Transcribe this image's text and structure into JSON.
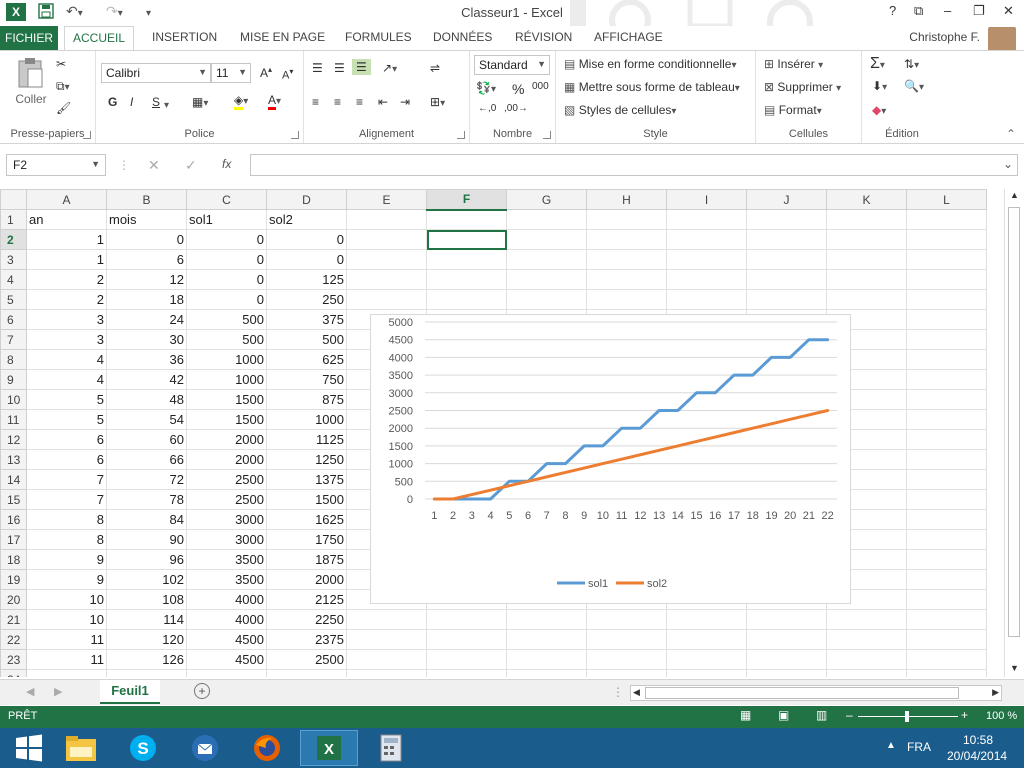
{
  "titlebar": {
    "title": "Classeur1 - Excel",
    "app_icon": "X",
    "help": "?",
    "buttons": [
      "?",
      "⧉",
      "–",
      "❐",
      "✕"
    ]
  },
  "tabs": {
    "file": "FICHIER",
    "items": [
      "ACCUEIL",
      "INSERTION",
      "MISE EN PAGE",
      "FORMULES",
      "DONNÉES",
      "RÉVISION",
      "AFFICHAGE"
    ],
    "active": "ACCUEIL",
    "user": "Christophe F."
  },
  "ribbon": {
    "clipboard": {
      "paste_label": "Coller",
      "group_label": "Presse-papiers"
    },
    "font": {
      "name": "Calibri",
      "size": "11",
      "bold": "G",
      "italic": "I",
      "underline": "S",
      "group_label": "Police"
    },
    "alignment": {
      "group_label": "Alignement"
    },
    "number": {
      "format": "Standard",
      "percent": "%",
      "thousands": "000",
      "group_label": "Nombre"
    },
    "styles": {
      "conditional": "Mise en forme conditionnelle",
      "table": "Mettre sous forme de tableau",
      "cell_styles": "Styles de cellules",
      "group_label": "Style"
    },
    "cells": {
      "insert": "Insérer",
      "delete": "Supprimer",
      "format": "Format",
      "group_label": "Cellules"
    },
    "editing": {
      "group_label": "Édition"
    }
  },
  "formula_bar": {
    "name_box": "F2",
    "fx": "fx",
    "value": ""
  },
  "sheet": {
    "columns": [
      "A",
      "B",
      "C",
      "D",
      "E",
      "F",
      "G",
      "H",
      "I",
      "J",
      "K",
      "L"
    ],
    "selected_cell": "F2",
    "header_row": [
      "an",
      "mois",
      "sol1",
      "sol2"
    ],
    "rows": [
      [
        1,
        0,
        0,
        0
      ],
      [
        1,
        6,
        0,
        0
      ],
      [
        2,
        12,
        0,
        125
      ],
      [
        2,
        18,
        0,
        250
      ],
      [
        3,
        24,
        500,
        375
      ],
      [
        3,
        30,
        500,
        500
      ],
      [
        4,
        36,
        1000,
        625
      ],
      [
        4,
        42,
        1000,
        750
      ],
      [
        5,
        48,
        1500,
        875
      ],
      [
        5,
        54,
        1500,
        1000
      ],
      [
        6,
        60,
        2000,
        1125
      ],
      [
        6,
        66,
        2000,
        1250
      ],
      [
        7,
        72,
        2500,
        1375
      ],
      [
        7,
        78,
        2500,
        1500
      ],
      [
        8,
        84,
        3000,
        1625
      ],
      [
        8,
        90,
        3000,
        1750
      ],
      [
        9,
        96,
        3500,
        1875
      ],
      [
        9,
        102,
        3500,
        2000
      ],
      [
        10,
        108,
        4000,
        2125
      ],
      [
        10,
        114,
        4000,
        2250
      ],
      [
        11,
        120,
        4500,
        2375
      ],
      [
        11,
        126,
        4500,
        2500
      ]
    ]
  },
  "chart_data": {
    "type": "line",
    "x": [
      1,
      2,
      3,
      4,
      5,
      6,
      7,
      8,
      9,
      10,
      11,
      12,
      13,
      14,
      15,
      16,
      17,
      18,
      19,
      20,
      21,
      22
    ],
    "series": [
      {
        "name": "sol1",
        "color": "#5b9bd5",
        "values": [
          0,
          0,
          0,
          0,
          500,
          500,
          1000,
          1000,
          1500,
          1500,
          2000,
          2000,
          2500,
          2500,
          3000,
          3000,
          3500,
          3500,
          4000,
          4000,
          4500,
          4500
        ]
      },
      {
        "name": "sol2",
        "color": "#ed7d31",
        "values": [
          0,
          0,
          125,
          250,
          375,
          500,
          625,
          750,
          875,
          1000,
          1125,
          1250,
          1375,
          1500,
          1625,
          1750,
          1875,
          2000,
          2125,
          2250,
          2375,
          2500
        ]
      }
    ],
    "yticks": [
      "0",
      "500",
      "1000",
      "1500",
      "2000",
      "2500",
      "3000",
      "3500",
      "4000",
      "4500",
      "5000"
    ],
    "ylim": [
      0,
      5000
    ],
    "grid": true,
    "legend": "bottom"
  },
  "sheet_tab": {
    "name": "Feuil1",
    "add": "+"
  },
  "statusbar": {
    "status": "PRÊT",
    "zoom": "100 %",
    "zoom_minus": "–",
    "zoom_plus": "+"
  },
  "taskbar": {
    "lang": "FRA",
    "time": "10:58",
    "date": "20/04/2014"
  }
}
